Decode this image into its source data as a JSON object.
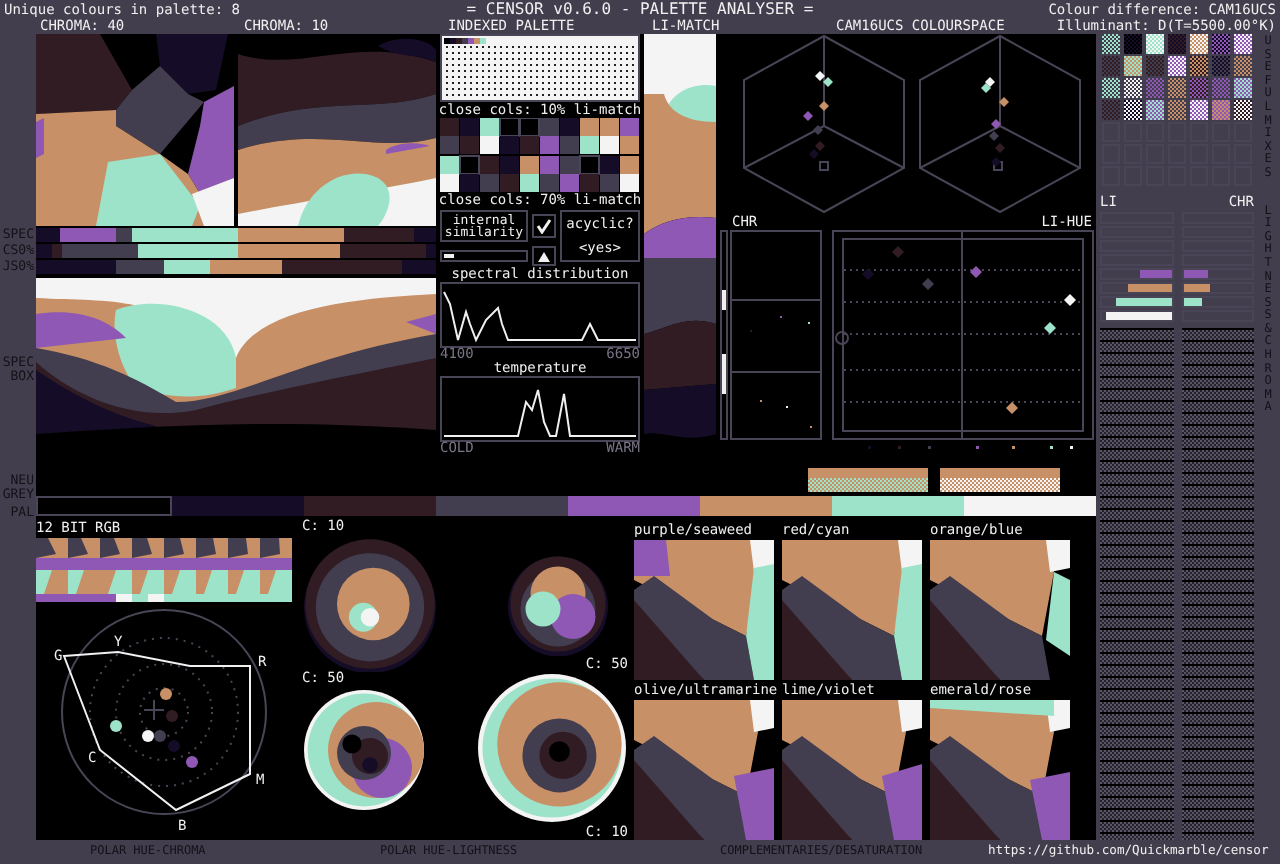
{
  "header": {
    "palette_count": "Unique colours in palette: 8",
    "title": "= CENSOR v0.6.0 - PALETTE ANALYSER =",
    "colour_difference": "Colour difference: CAM16UCS",
    "illuminant": "Illuminant: D(T=5500.00°K)"
  },
  "palette": [
    {
      "color": "#000000"
    },
    {
      "color": "#150c27"
    },
    {
      "color": "#311c24"
    },
    {
      "color": "#433e4f"
    },
    {
      "color": "#8e58b4"
    },
    {
      "color": "#c89066"
    },
    {
      "color": "#9ce3c9"
    },
    {
      "color": "#f4f4f4"
    }
  ],
  "top_labels": {
    "chroma_40": "CHROMA: 40",
    "chroma_10": "CHROMA: 10",
    "indexed_palette": "INDEXED PALETTE",
    "li_match": "LI-MATCH",
    "colourspace": "CAM16UCS COLOURSPACE"
  },
  "close_cols": [
    "close cols: 10% li-match",
    "close cols: 70% li-match"
  ],
  "internal_similarity": {
    "label": "internal similarity",
    "checked": true,
    "level": 0.12
  },
  "acyclic": {
    "label": "acyclic?",
    "value": "<yes>"
  },
  "spectral": {
    "title": "spectral distribution",
    "min": "4100",
    "max": "6650"
  },
  "temperature": {
    "title": "temperature",
    "min": "COLD",
    "max": "WARM"
  },
  "row_labels": {
    "spec": "SPEC",
    "cs": "CS0%",
    "js": "JS0%",
    "spec_box": "SPEC BOX",
    "neu_grey": "NEU GREY",
    "pal": "PAL"
  },
  "plots": {
    "chr": "CHR",
    "li_hue": "LI-HUE"
  },
  "side": {
    "li": "LI",
    "chr": "CHR",
    "useful_mixes": "USEFUL MIXES",
    "lightness_chroma": "LIGHTNESS & CHROMA"
  },
  "rgb12": "12 BIT RGB",
  "polar_chroma": {
    "labels": [
      "G",
      "Y",
      "R",
      "C",
      "M",
      "B"
    ],
    "caption": "POLAR HUE-CHROMA"
  },
  "polar_lightness": {
    "chroma_labels": [
      "C: 10",
      "C: 50",
      "C: 50",
      "C: 10"
    ],
    "caption": "POLAR HUE-LIGHTNESS"
  },
  "complementaries": {
    "pairs": [
      "purple/seaweed",
      "red/cyan",
      "orange/blue",
      "olive/ultramarine",
      "lime/violet",
      "emerald/rose"
    ],
    "caption": "COMPLEMENTARIES/DESATURATION"
  },
  "link": "https://github.com/Quickmarble/censor"
}
